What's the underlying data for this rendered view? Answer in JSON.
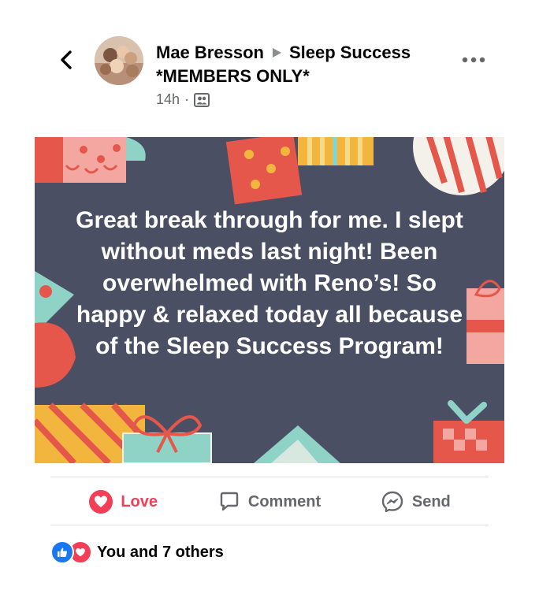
{
  "header": {
    "author": "Mae Bresson",
    "group": "Sleep Success",
    "group_line2": "*MEMBERS ONLY*",
    "time": "14h",
    "separator": "·",
    "back_icon": "chevron-left-icon",
    "privacy_icon": "group-members-icon",
    "more_icon": "more-horizontal-icon"
  },
  "post": {
    "image_text": "Great break through for me. I slept without meds last night! Been overwhelmed with Reno’s! So happy & relaxed today all because of the Sleep Success Program!"
  },
  "actions": {
    "love": "Love",
    "comment": "Comment",
    "send": "Send"
  },
  "reactions": {
    "summary": "You and 7 others"
  },
  "colors": {
    "love": "#f33e58",
    "like": "#1877f2",
    "image_bg": "#4a4f63",
    "muted_text": "#65676b"
  }
}
